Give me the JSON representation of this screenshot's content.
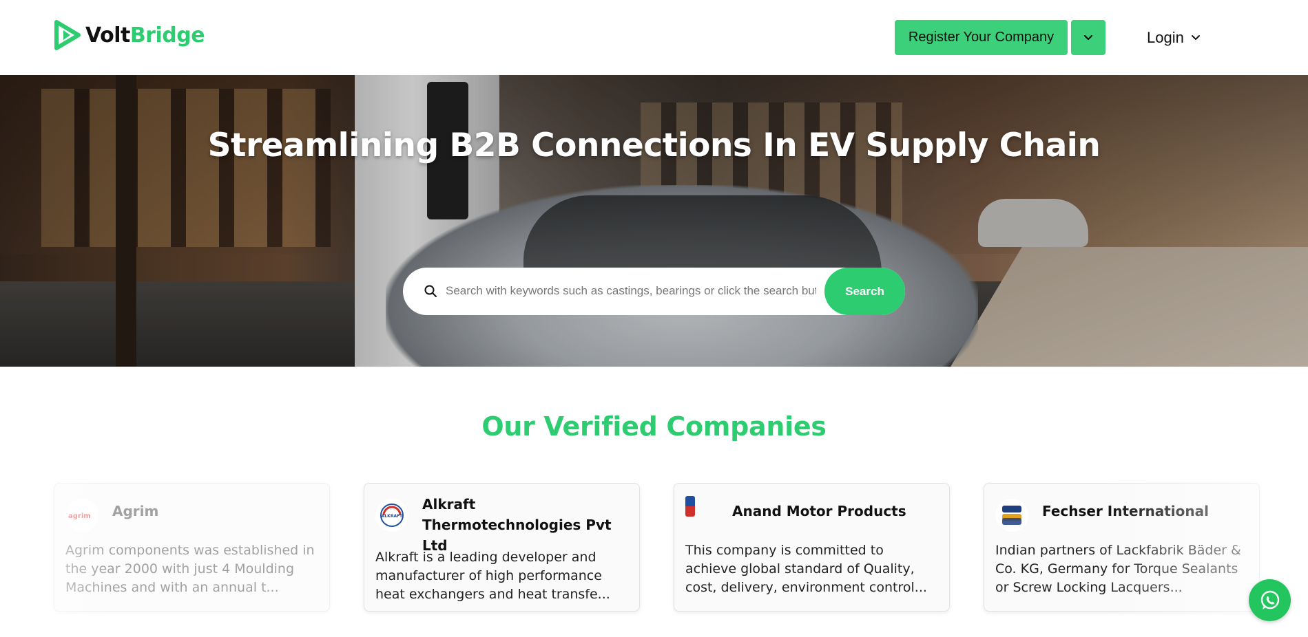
{
  "brand": {
    "part1": "Volt",
    "part2": "Bridge",
    "accent": "#2ecc71"
  },
  "header": {
    "register_label": "Register Your Company",
    "login_label": "Login"
  },
  "hero": {
    "title": "Streamlining B2B Connections In EV Supply Chain",
    "search": {
      "placeholder": "Search with keywords such as castings, bearings or click the search button",
      "button_label": "Search"
    }
  },
  "companies": {
    "title": "Our Verified Companies",
    "items": [
      {
        "name": "Agrim",
        "logo": "agrim-logo",
        "description": "Agrim components was established in the year 2000 with just 4 Moulding Machines and with an annual t..."
      },
      {
        "name": "Alkraft Thermotechnologies Pvt Ltd",
        "logo": "alkraft-logo",
        "logo_text": "ALKRAFT",
        "description": "Alkraft is a leading developer and manufacturer of high performance heat exchangers and heat transfe..."
      },
      {
        "name": "Anand Motor Products",
        "logo": "anand-logo",
        "description": "This company is committed to achieve global standard of Quality, cost, delivery, environment control..."
      },
      {
        "name": "Fechser International",
        "logo": "fechser-logo",
        "description": "Indian partners of Lackfabrik Bäder & Co. KG, Germany for Torque Sealants or Screw Locking Lacquers..."
      }
    ]
  },
  "icons": {
    "logo": "voltbridge-logo-icon",
    "dropdown": "chevron-down-icon",
    "search": "search-icon",
    "whatsapp": "whatsapp-icon"
  }
}
